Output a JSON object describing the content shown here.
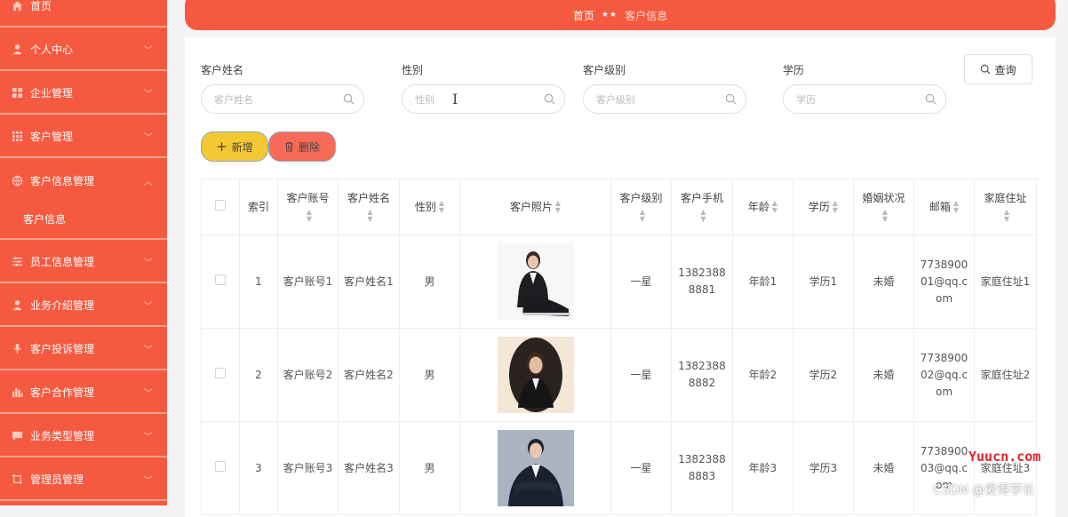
{
  "sidebar": {
    "items": [
      {
        "label": "首页",
        "icon": "home-icon"
      },
      {
        "label": "个人中心",
        "icon": "user-icon"
      },
      {
        "label": "企业管理",
        "icon": "grid-icon"
      },
      {
        "label": "客户管理",
        "icon": "apps-icon"
      },
      {
        "label": "客户信息管理",
        "icon": "globe-icon",
        "expanded": true
      },
      {
        "label": "员工信息管理",
        "icon": "sliders-icon"
      },
      {
        "label": "业务介绍管理",
        "icon": "user-icon"
      },
      {
        "label": "客户投诉管理",
        "icon": "microphone-icon"
      },
      {
        "label": "客户合作管理",
        "icon": "bar-chart-icon"
      },
      {
        "label": "业务类型管理",
        "icon": "message-icon"
      },
      {
        "label": "管理员管理",
        "icon": "crop-icon"
      }
    ],
    "sub_items": [
      {
        "label": "客户信息"
      }
    ]
  },
  "breadcrumb": {
    "home": "首页",
    "separator": "★★",
    "current": "客户信息"
  },
  "search": {
    "fields": [
      {
        "label": "客户姓名",
        "placeholder": "客户姓名"
      },
      {
        "label": "性别",
        "placeholder": "性别"
      },
      {
        "label": "客户级别",
        "placeholder": "客户级别"
      },
      {
        "label": "学历",
        "placeholder": "学历"
      }
    ],
    "query_button": "查询"
  },
  "actions": {
    "add": "新增",
    "delete": "删除"
  },
  "table": {
    "columns": [
      "索引",
      "客户账号",
      "客户姓名",
      "性别",
      "客户照片",
      "客户级别",
      "客户手机",
      "年龄",
      "学历",
      "婚姻状况",
      "邮箱",
      "家庭住址"
    ],
    "rows": [
      {
        "index": "1",
        "account": "客户账号1",
        "name": "客户姓名1",
        "gender": "男",
        "level": "一星",
        "phone": "13823888881",
        "age": "年龄1",
        "education": "学历1",
        "marital": "未婚",
        "email": "773890001@qq.com",
        "address": "家庭住址1"
      },
      {
        "index": "2",
        "account": "客户账号2",
        "name": "客户姓名2",
        "gender": "男",
        "level": "一星",
        "phone": "13823888882",
        "age": "年龄2",
        "education": "学历2",
        "marital": "未婚",
        "email": "773890002@qq.com",
        "address": "家庭住址2"
      },
      {
        "index": "3",
        "account": "客户账号3",
        "name": "客户姓名3",
        "gender": "男",
        "level": "一星",
        "phone": "13823888883",
        "age": "年龄3",
        "education": "学历3",
        "marital": "未婚",
        "email": "773890003@qq.com",
        "address": "家庭住址3"
      }
    ]
  },
  "watermarks": {
    "site": "Yuucn.com",
    "author": "CSDN @爱得学长"
  },
  "colors": {
    "accent": "#f55a40",
    "add_button": "#f3c832",
    "delete_button": "#f76a57"
  }
}
